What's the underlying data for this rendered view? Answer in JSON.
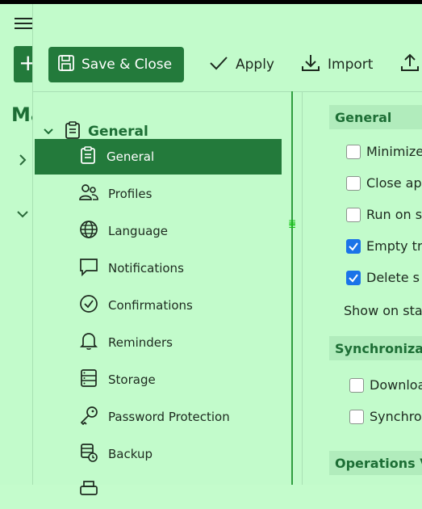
{
  "background": {
    "title": "Ma",
    "plus_label": "+"
  },
  "toolbar": {
    "save_close": "Save & Close",
    "apply": "Apply",
    "import": "Import"
  },
  "nav": {
    "header": "General",
    "items": [
      {
        "label": "General",
        "icon": "clipboard-icon",
        "active": true
      },
      {
        "label": "Profiles",
        "icon": "users-icon"
      },
      {
        "label": "Language",
        "icon": "globe-icon"
      },
      {
        "label": "Notifications",
        "icon": "message-icon"
      },
      {
        "label": "Confirmations",
        "icon": "check-circle-icon"
      },
      {
        "label": "Reminders",
        "icon": "bell-icon"
      },
      {
        "label": "Storage",
        "icon": "database-icon"
      },
      {
        "label": "Password Protection",
        "icon": "key-icon"
      },
      {
        "label": "Backup",
        "icon": "backup-icon"
      }
    ]
  },
  "content": {
    "general": {
      "title": "General",
      "options": [
        {
          "label": "Minimize",
          "checked": false
        },
        {
          "label": "Close ap",
          "checked": false
        },
        {
          "label": "Run on s",
          "checked": false
        },
        {
          "label": "Empty tr",
          "checked": true
        },
        {
          "label": "Delete s",
          "checked": true
        }
      ],
      "show_on_start": "Show on sta"
    },
    "sync": {
      "title": "Synchronizat",
      "options": [
        {
          "label": "Downloa",
          "checked": false
        },
        {
          "label": "Synchron",
          "checked": false
        }
      ]
    },
    "operations": {
      "title": "Operations V"
    }
  },
  "colors": {
    "accent": "#237a3b",
    "background": "#c2fbcb",
    "checkbox_checked": "#1a73e8"
  }
}
